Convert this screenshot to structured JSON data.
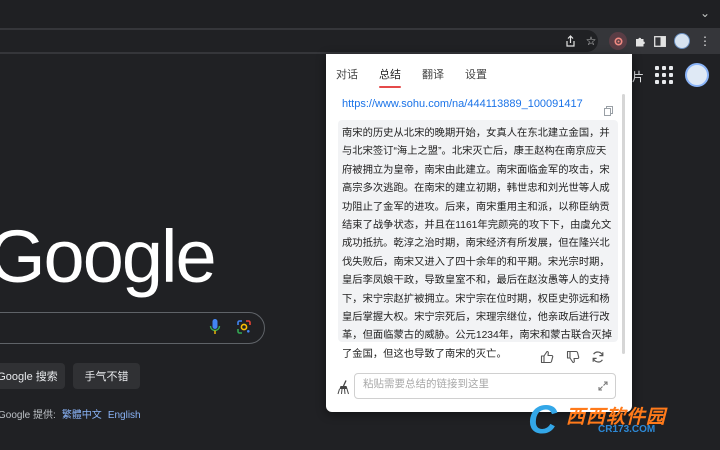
{
  "google": {
    "images_link": "图片",
    "search_button": "Google 搜索",
    "lucky_button": "手气不错",
    "offered_prefix": "Google 提供:",
    "lang_traditional": "繁體中文",
    "lang_english": "English"
  },
  "panel": {
    "tabs": [
      "对话",
      "总结",
      "翻译",
      "设置"
    ],
    "active_tab": "总结",
    "url": "https://www.sohu.com/na/444113889_100091417",
    "summary": "南宋的历史从北宋的晚期开始，女真人在东北建立金国，并与北宋签订“海上之盟”。北宋灭亡后，康王赵构在南京应天府被拥立为皇帝，南宋由此建立。南宋面临金军的攻击，宋高宗多次逃跑。在南宋的建立初期，韩世忠和刘光世等人成功阻止了金军的进攻。后来，南宋重用主和派，以称臣纳贡结束了战争状态，并且在1161年完颜亮的攻下下，由虞允文成功抵抗。乾淳之治时期，南宋经济有所发展，但在隆兴北伐失败后，南宋又进入了四十余年的和平期。宋光宗时期，皇后李凤娘干政，导致皇室不和，最后在赵汝愚等人的支持下，宋宁宗赵扩被拥立。宋宁宗在位时期，权臣史弥远和杨皇后掌握大权。宋宁宗死后，宋理宗继位，他亲政后进行改革，但面临蒙古的威胁。公元1234年，南宋和蒙古联合灭掉了金国，但这也导致了南宋的灭亡。",
    "input_placeholder": "粘贴需要总结的链接到这里"
  },
  "watermark": {
    "brand": "西西软件园",
    "domain": "CR173.COM"
  },
  "colors": {
    "accent_underline": "#e54a4a",
    "link": "#1a73e8",
    "dark_bg": "#202124"
  }
}
